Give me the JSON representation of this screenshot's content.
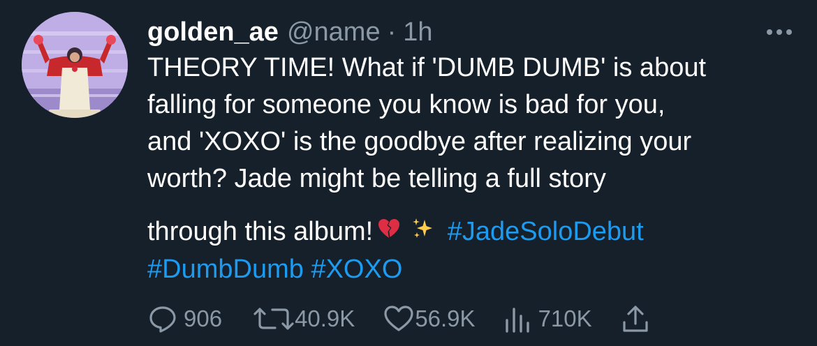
{
  "tweet": {
    "display_name": "golden_ae",
    "handle": "@name",
    "separator": "·",
    "time": "1h",
    "text_lines": [
      "THEORY TIME! What if 'DUMB DUMB' is about",
      "falling for someone you know is bad for you,",
      "and 'XOXO' is the goodbye after realizing your",
      "worth? Jade might be telling a full story"
    ],
    "text_line5": "through this album!",
    "emojis": [
      "broken-heart-emoji",
      "sparkles-emoji"
    ],
    "hashtags": [
      "#JadeSoloDebut",
      "#DumbDumb",
      "#XOXO"
    ]
  },
  "actions": {
    "replies": "906",
    "retweets": "40.9K",
    "likes": "56.9K",
    "views": "710K"
  },
  "icons": [
    "more-icon",
    "reply-icon",
    "retweet-icon",
    "like-icon",
    "views-icon",
    "share-icon"
  ],
  "colors": {
    "background": "#15202b",
    "text": "#ffffff",
    "secondary": "#8b98a5",
    "accent": "#1d9bf0"
  }
}
